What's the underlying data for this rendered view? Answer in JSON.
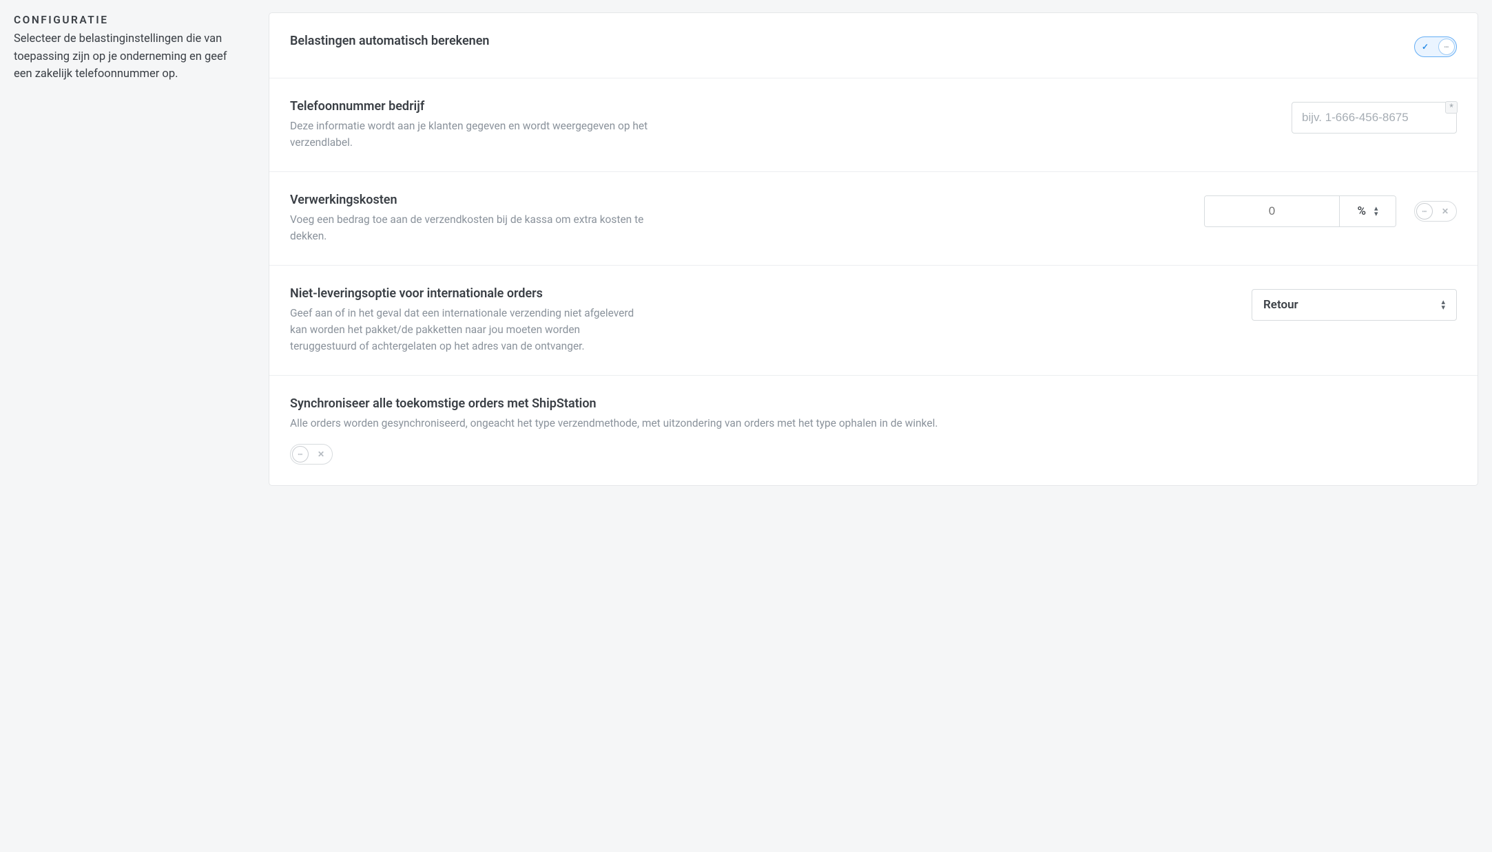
{
  "sidebar": {
    "title": "CONFIGURATIE",
    "description": "Selecteer de belastinginstellingen die van toepassing zijn op je onderneming en geef een zakelijk telefoonnummer op."
  },
  "rows": {
    "auto_tax": {
      "title": "Belastingen automatisch berekenen",
      "toggle_on": true
    },
    "phone": {
      "title": "Telefoonnummer bedrijf",
      "desc": "Deze informatie wordt aan je klanten gegeven en wordt weergegeven op het verzendlabel.",
      "placeholder": "bijv. 1-666-456-8675",
      "value": "",
      "required_mark": "*"
    },
    "handling": {
      "title": "Verwerkingskosten",
      "desc": "Voeg een bedrag toe aan de verzendkosten bij de kassa om extra kosten te dekken.",
      "value": "0",
      "unit": "%",
      "toggle_on": false
    },
    "nondelivery": {
      "title": "Niet-leveringsoptie voor internationale orders",
      "desc": "Geef aan of in het geval dat een internationale verzending niet afgeleverd kan worden het pakket/de pakketten naar jou moeten worden teruggestuurd of achtergelaten op het adres van de ontvanger.",
      "selected": "Retour"
    },
    "sync": {
      "title": "Synchroniseer alle toekomstige orders met ShipStation",
      "desc": "Alle orders worden gesynchroniseerd, ongeacht het type verzendmethode, met uitzondering van orders met het type ophalen in de winkel.",
      "toggle_on": false
    }
  },
  "glyphs": {
    "check": "✓",
    "x": "✕",
    "dots": "┅",
    "caret_up": "▴",
    "caret_down": "▾"
  }
}
